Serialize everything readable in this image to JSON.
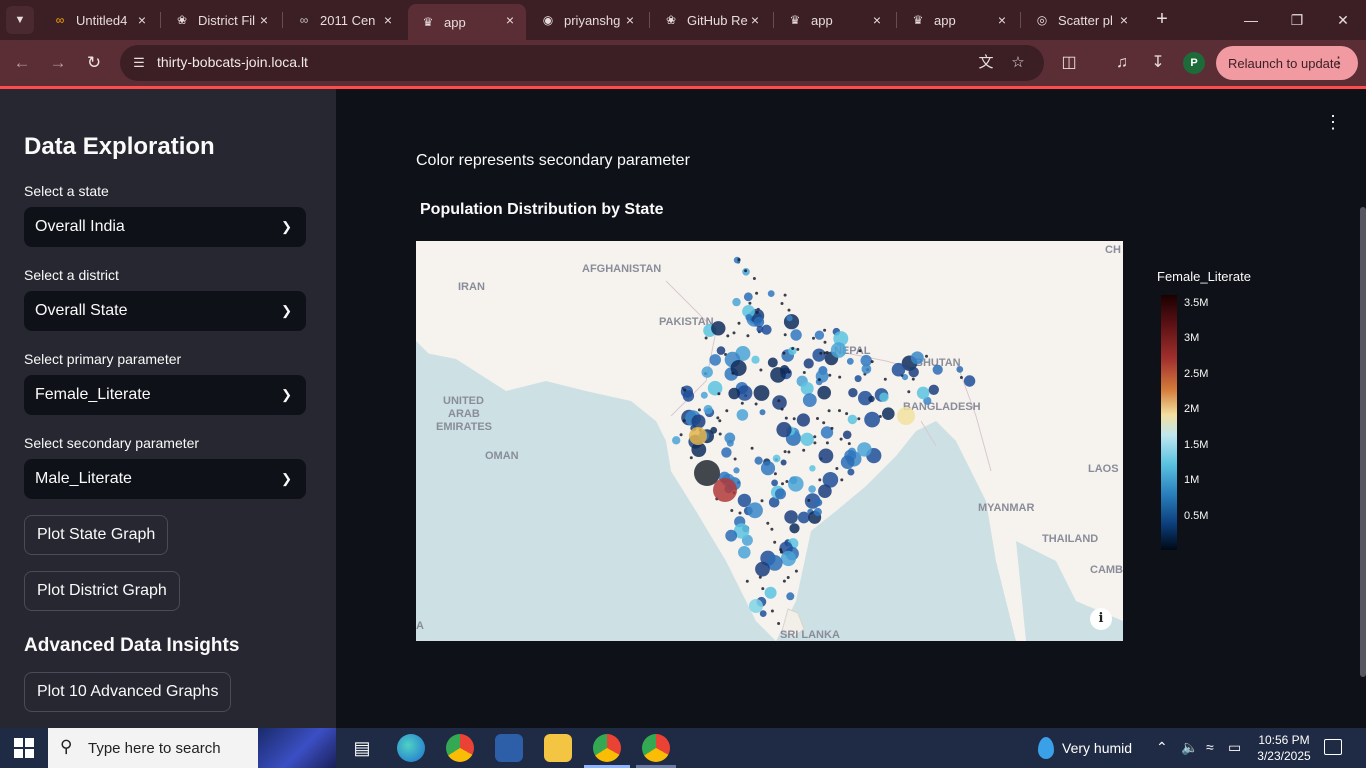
{
  "browser": {
    "tabs": [
      {
        "title": "Untitled4",
        "active": false
      },
      {
        "title": "District Fil",
        "active": false
      },
      {
        "title": "2011 Cen",
        "active": false
      },
      {
        "title": "app",
        "active": true
      },
      {
        "title": "priyanshg",
        "active": false
      },
      {
        "title": "GitHub Re",
        "active": false
      },
      {
        "title": "app",
        "active": false
      },
      {
        "title": "app",
        "active": false
      },
      {
        "title": "Scatter pl",
        "active": false
      }
    ],
    "url": "thirty-bobcats-join.loca.lt",
    "relaunch_label": "Relaunch to update",
    "profile_initial": "P",
    "accent_color": "#5b2e36"
  },
  "sidebar": {
    "title": "Data Exploration",
    "state_label": "Select a state",
    "state_value": "Overall India",
    "district_label": "Select a district",
    "district_value": "Overall State",
    "primary_label": "Select primary parameter",
    "primary_value": "Female_Literate",
    "secondary_label": "Select secondary parameter",
    "secondary_value": "Male_Literate",
    "plot_state_button": "Plot State Graph",
    "plot_district_button": "Plot District Graph",
    "advanced_heading": "Advanced Data Insights",
    "advanced_button": "Plot 10 Advanced Graphs"
  },
  "main": {
    "caption": "Color represents secondary parameter",
    "plot_title": "Population Distribution by State",
    "map_labels": {
      "afghanistan": "AFGHANISTAN",
      "iran": "IRAN",
      "pakistan": "PAKISTAN",
      "nepal": "NEPAL",
      "bhutan": "BHUTAN",
      "bangladesh": "BANGLADESH",
      "uae_1": "UNITED",
      "uae_2": "ARAB",
      "uae_3": "EMIRATES",
      "oman": "OMAN",
      "laos": "LAOS",
      "myanmar": "MYANMAR",
      "thailand": "THAILAND",
      "cambodia": "CAMB",
      "sri_lanka": "SRI LANKA",
      "china": "CH",
      "edge_a": "A"
    }
  },
  "chart_data": {
    "type": "scatter",
    "title": "Population Distribution by State",
    "colorbar_title": "Female_Literate",
    "colorbar_ticks": [
      "3.5M",
      "3M",
      "2.5M",
      "2M",
      "1.5M",
      "1M",
      "0.5M"
    ],
    "color_range": [
      0,
      3700000
    ],
    "colorscale": "icefire"
  },
  "taskbar": {
    "search_placeholder": "Type here to search",
    "weather": "Very humid",
    "time": "10:56 PM",
    "date": "3/23/2025"
  }
}
